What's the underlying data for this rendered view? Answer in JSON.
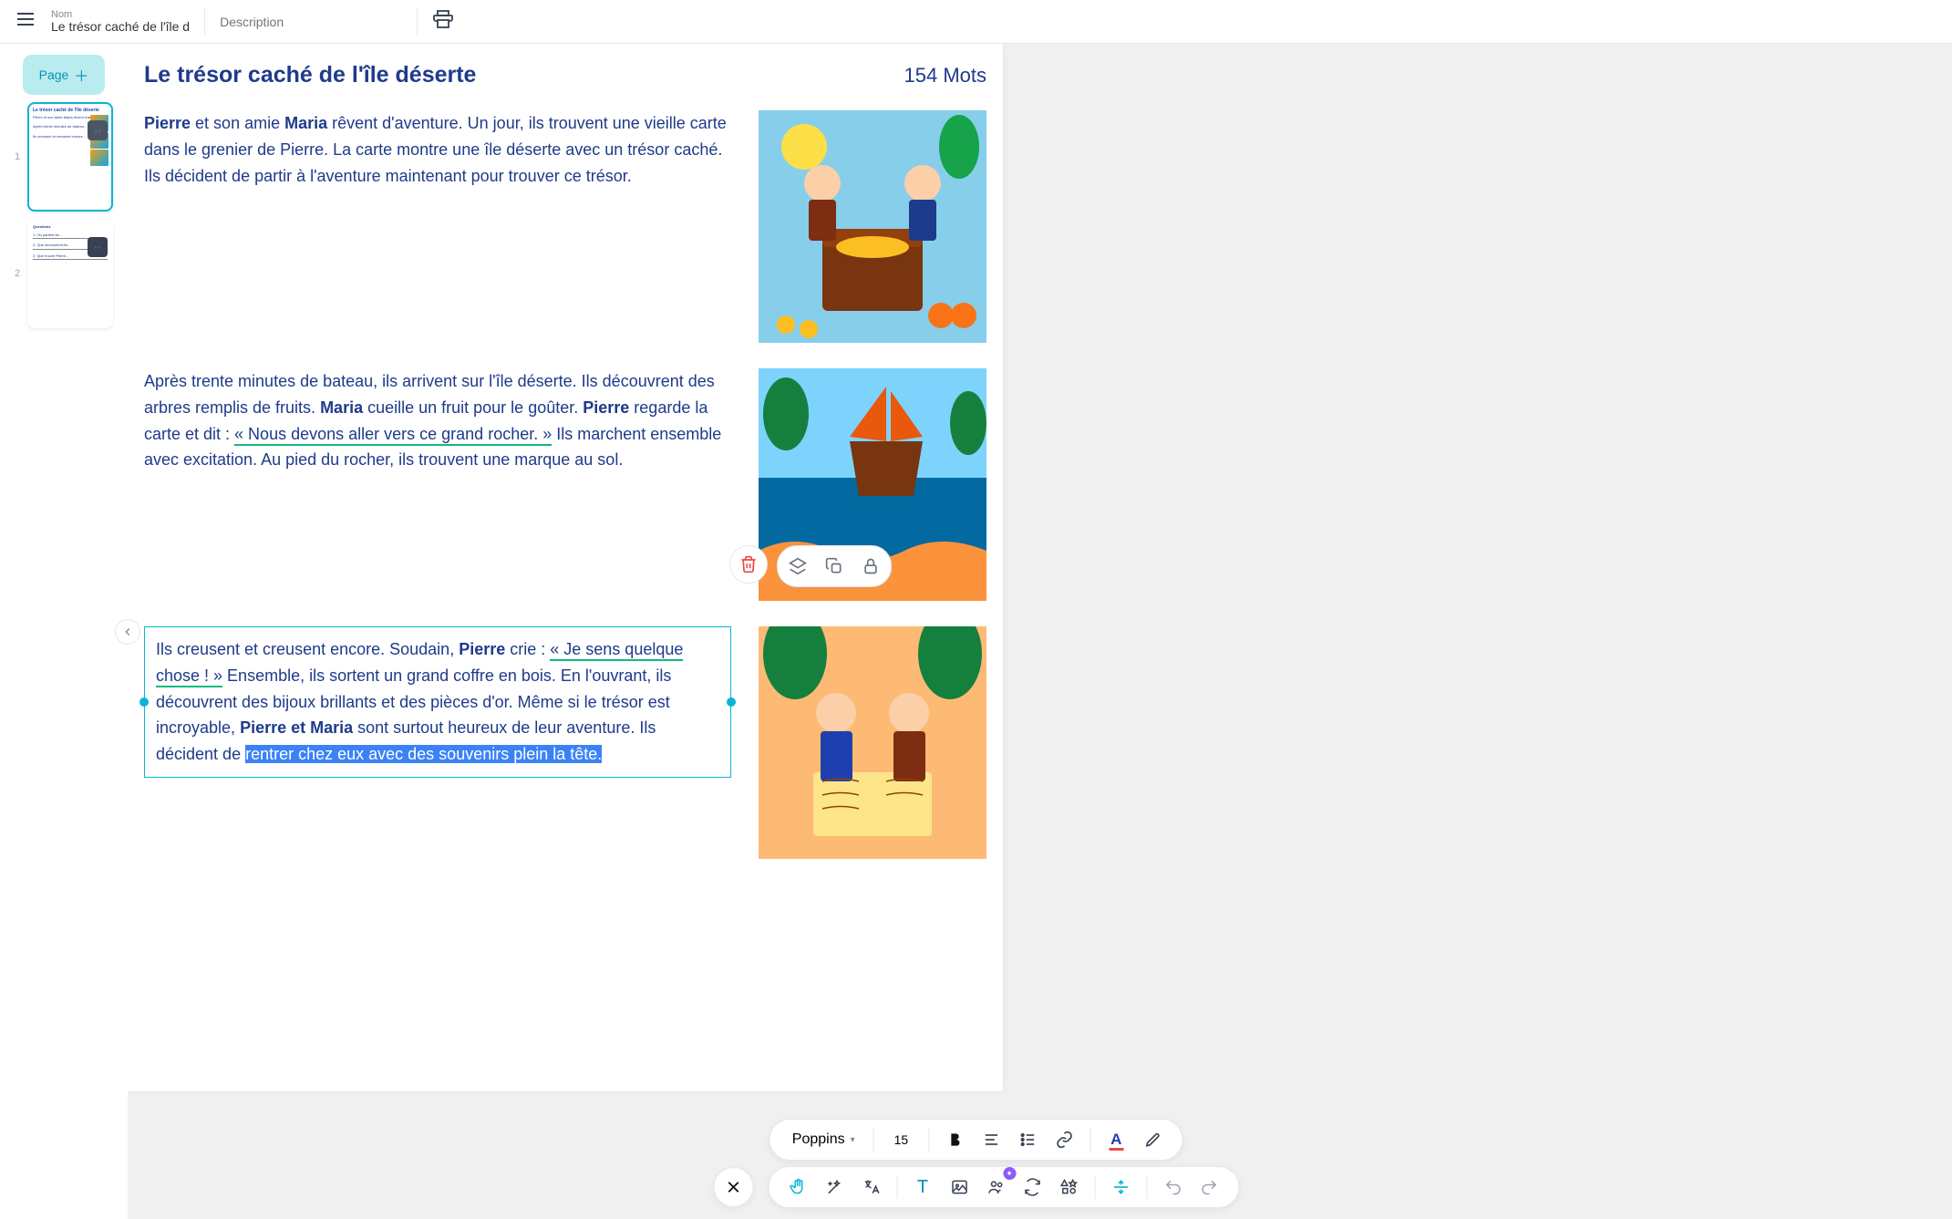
{
  "topbar": {
    "name_label": "Nom",
    "name_value": "Le trésor caché de l'île d",
    "description_placeholder": "Description"
  },
  "sidebar": {
    "page_button": "Page",
    "thumbnails": [
      {
        "num": "1",
        "active": true
      },
      {
        "num": "2",
        "active": false
      }
    ]
  },
  "document": {
    "title": "Le trésor caché de l'île déserte",
    "word_count": "154 Mots",
    "para1": {
      "s1a": "Pierre",
      "s1b": " et son amie ",
      "s1c": "Maria",
      "s1d": " rêvent d'aventure. Un jour, ils trouvent une vieille carte dans le grenier de Pierre. La carte montre une île déserte avec un trésor caché. Ils décident de partir à l'aventure maintenant pour trouver ce trésor."
    },
    "para2": {
      "s2a": "Après trente minutes de bateau, ils arrivent sur l'île déserte. Ils découvrent des arbres remplis de fruits. ",
      "s2b": "Maria",
      "s2c": " cueille un fruit pour le goûter. ",
      "s2d": "Pierre",
      "s2e": " regarde la carte et dit : ",
      "s2f": "« Nous devons aller vers ce grand rocher. »",
      "s2g": " Ils marchent ensemble avec excitation. Au pied du rocher, ils trouvent une marque au sol."
    },
    "para3": {
      "s3a": "Ils creusent et creusent encore. Soudain, ",
      "s3b": "Pierre",
      "s3c": " crie : ",
      "s3d": "« Je sens quelque chose ! »",
      "s3e": " Ensemble, ils sortent un grand coffre en bois. En l'ouvrant, ils découvrent des bijoux brillants et des pièces d'or. Même si le trésor est incroyable, ",
      "s3f": "Pierre et Maria",
      "s3g": " sont surtout heureux de leur aventure. Ils décident de ",
      "s3h": "rentrer chez eux avec des souvenirs plein la tête."
    }
  },
  "text_toolbar": {
    "font": "Poppins",
    "size": "15"
  }
}
